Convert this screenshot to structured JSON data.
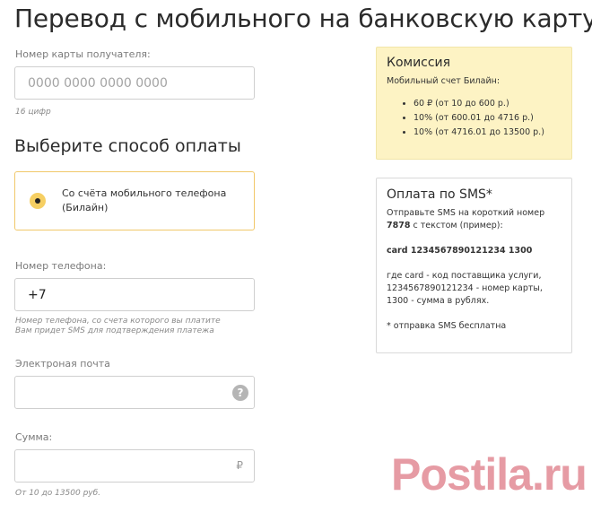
{
  "page_title": "Перевод с мобильного на банковскую карту",
  "card": {
    "label": "Номер карты получателя:",
    "placeholder": "0000 0000 0000 0000",
    "hint": "16 цифр"
  },
  "payment_method": {
    "title": "Выберите способ оплаты",
    "option_label": "Со счёта мобильного телефона (Билайн)"
  },
  "phone": {
    "label": "Номер телефона:",
    "value": "+7",
    "hint_line1": "Номер телефона, со счета которого вы платите",
    "hint_line2": "Вам придет SMS для подтверждения платежа"
  },
  "email": {
    "label": "Электроная почта",
    "help_icon": "?"
  },
  "amount": {
    "label": "Сумма:",
    "currency_icon": "₽",
    "hint": "От 10 до 13500 руб."
  },
  "commission": {
    "title": "Комиссия",
    "subtitle": "Мобильный счет Билайн:",
    "items": [
      "60 ₽ (от 10 до 600 р.)",
      "10% (от 600.01 до 4716 р.)",
      "10% (от 4716.01 до 13500 р.)"
    ]
  },
  "sms_payment": {
    "title": "Оплата по SMS*",
    "intro_prefix": "Отправьте SMS на короткий номер",
    "short_number": "7878",
    "intro_suffix": "с текстом (пример):",
    "example": "card 1234567890121234 1300",
    "explain_line1": "где card - код поставщика услуги,",
    "explain_line2": "1234567890121234 - номер карты,",
    "explain_line3": "1300 - сумма в рублях.",
    "footnote": "* отправка SMS бесплатна"
  },
  "watermark": "Postila.ru",
  "colors": {
    "accent_yellow": "#f6cf63",
    "commission_bg": "#fdf3c4",
    "watermark": "#d24a5a"
  }
}
